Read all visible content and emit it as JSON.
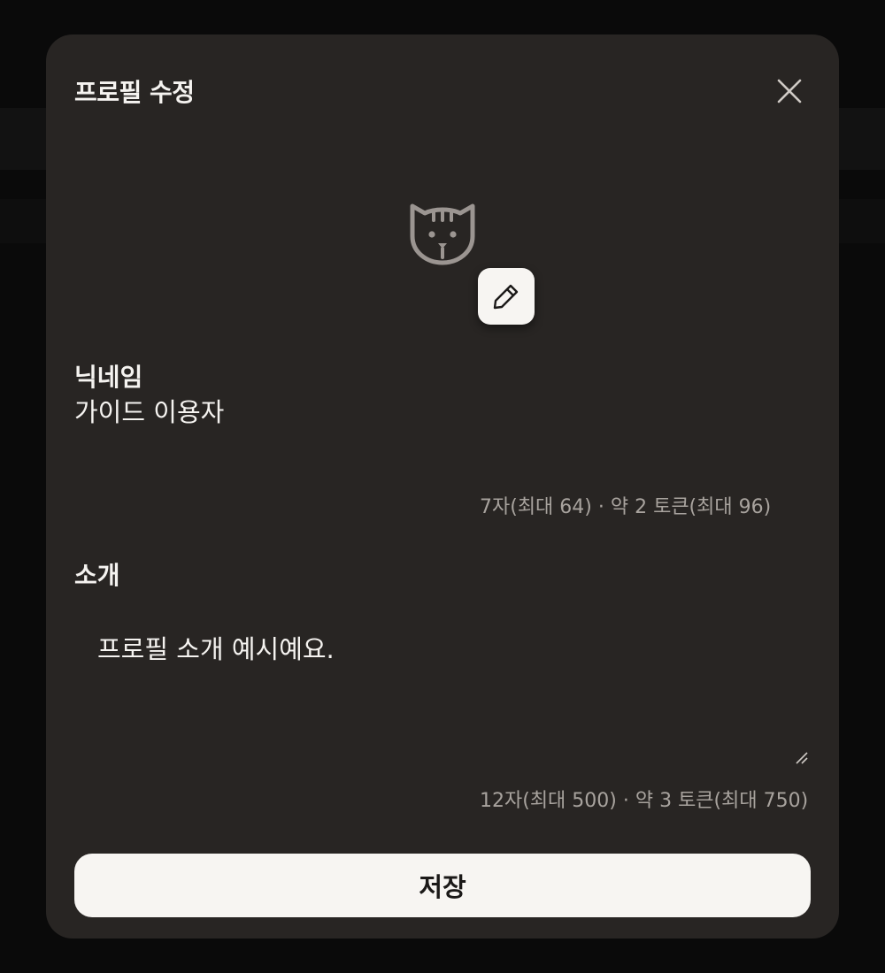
{
  "modal": {
    "title": "프로필 수정",
    "close_icon": "close-icon",
    "avatar_icon": "cat-face-icon",
    "edit_avatar_icon": "pencil-icon"
  },
  "nickname": {
    "label": "닉네임",
    "value": "가이드 이용자",
    "counter": "7자(최대 64) · 약 2 토큰(최대 96)"
  },
  "bio": {
    "label": "소개",
    "value": "프로필 소개 예시예요.",
    "counter": "12자(최대 500) · 약 3 토큰(최대 750)"
  },
  "save_label": "저장",
  "colors": {
    "modal_bg": "#282523",
    "page_bg": "#0a0a0a",
    "text_primary": "#f5f3f0",
    "text_secondary": "#a8a39e",
    "button_bg": "#f7f5f2",
    "icon_gray": "#9b9591"
  }
}
